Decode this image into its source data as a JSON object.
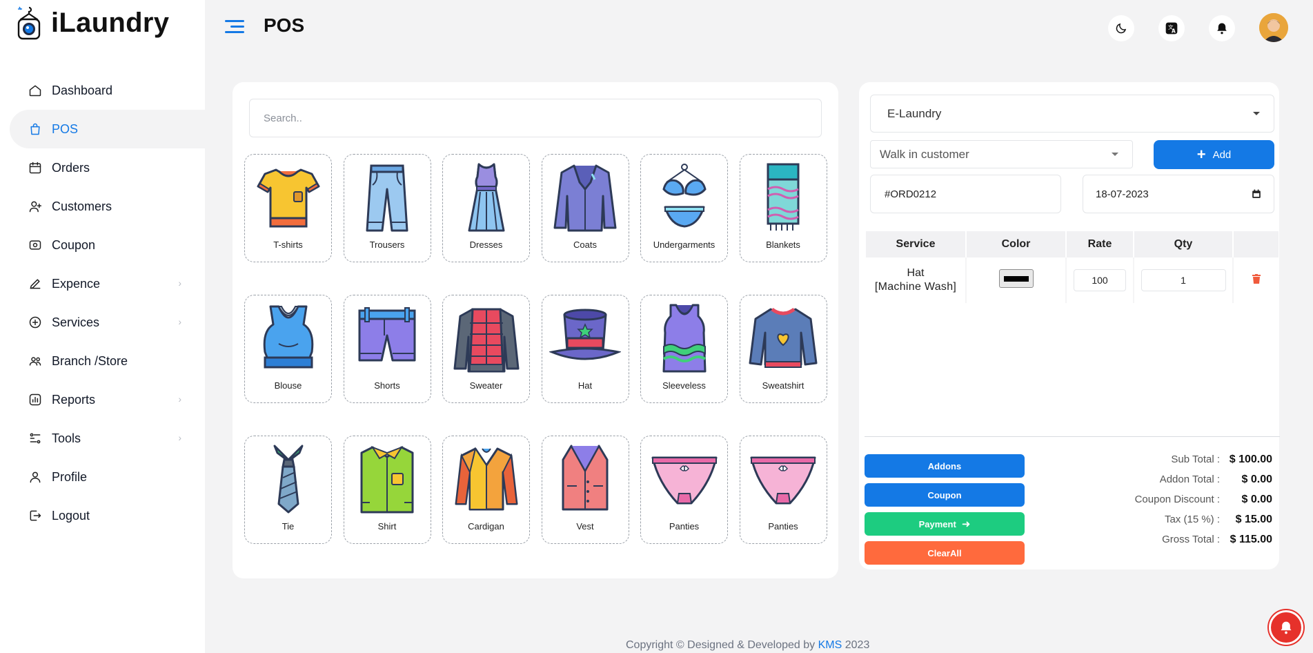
{
  "app": {
    "name": "iLaundry",
    "page_title": "POS"
  },
  "sidebar": {
    "items": [
      {
        "label": "Dashboard",
        "icon": "home-icon",
        "active": false,
        "has_submenu": false
      },
      {
        "label": "POS",
        "icon": "bag-icon",
        "active": true,
        "has_submenu": false
      },
      {
        "label": "Orders",
        "icon": "calendar-icon",
        "active": false,
        "has_submenu": false
      },
      {
        "label": "Customers",
        "icon": "user-plus-icon",
        "active": false,
        "has_submenu": false
      },
      {
        "label": "Coupon",
        "icon": "coupon-icon",
        "active": false,
        "has_submenu": false
      },
      {
        "label": "Expence",
        "icon": "pen-icon",
        "active": false,
        "has_submenu": true
      },
      {
        "label": "Services",
        "icon": "plus-circle-icon",
        "active": false,
        "has_submenu": true
      },
      {
        "label": "Branch /Store",
        "icon": "users-icon",
        "active": false,
        "has_submenu": false
      },
      {
        "label": "Reports",
        "icon": "chart-icon",
        "active": false,
        "has_submenu": true
      },
      {
        "label": "Tools",
        "icon": "tools-icon",
        "active": false,
        "has_submenu": true
      },
      {
        "label": "Profile",
        "icon": "user-icon",
        "active": false,
        "has_submenu": false
      },
      {
        "label": "Logout",
        "icon": "logout-icon",
        "active": false,
        "has_submenu": false
      }
    ]
  },
  "topbar": {
    "icons": [
      "moon-icon",
      "translate-icon",
      "bell-icon"
    ]
  },
  "products": {
    "search_placeholder": "Search..",
    "items": [
      {
        "label": "T-shirts",
        "icon": "tshirt-icon"
      },
      {
        "label": "Trousers",
        "icon": "trousers-icon"
      },
      {
        "label": "Dresses",
        "icon": "dress-icon"
      },
      {
        "label": "Coats",
        "icon": "coat-icon"
      },
      {
        "label": "Undergarments",
        "icon": "undergarments-icon"
      },
      {
        "label": "Blankets",
        "icon": "blanket-icon"
      },
      {
        "label": "Blouse",
        "icon": "blouse-icon"
      },
      {
        "label": "Shorts",
        "icon": "shorts-icon"
      },
      {
        "label": "Sweater",
        "icon": "sweater-icon"
      },
      {
        "label": "Hat",
        "icon": "hat-icon"
      },
      {
        "label": "Sleeveless",
        "icon": "sleeveless-icon"
      },
      {
        "label": "Sweatshirt",
        "icon": "sweatshirt-icon"
      },
      {
        "label": "Tie",
        "icon": "tie-icon"
      },
      {
        "label": "Shirt",
        "icon": "shirt-icon"
      },
      {
        "label": "Cardigan",
        "icon": "cardigan-icon"
      },
      {
        "label": "Vest",
        "icon": "vest-icon"
      },
      {
        "label": "Panties",
        "icon": "panties-icon"
      },
      {
        "label": "Panties",
        "icon": "panties-icon"
      }
    ]
  },
  "order": {
    "store": "E-Laundry",
    "customer": "Walk in customer",
    "add_label": "Add",
    "order_no": "#ORD0212",
    "date": "18-07-2023",
    "columns": [
      "Service",
      "Color",
      "Rate",
      "Qty"
    ],
    "rows": [
      {
        "service": "Hat",
        "method": "[Machine Wash]",
        "color": "#000000",
        "rate": "100",
        "qty": "1"
      }
    ],
    "buttons": {
      "addons": "Addons",
      "coupon": "Coupon",
      "payment": "Payment",
      "clear": "ClearAll"
    },
    "totals": [
      {
        "label": "Sub Total :",
        "value": "$ 100.00"
      },
      {
        "label": "Addon Total :",
        "value": "$ 0.00"
      },
      {
        "label": "Coupon Discount :",
        "value": "$ 0.00"
      },
      {
        "label": "Tax (15 %) :",
        "value": "$ 15.00"
      },
      {
        "label": "Gross Total :",
        "value": "$ 115.00"
      }
    ]
  },
  "footer": {
    "prefix": "Copyright © Designed & Developed by",
    "company": "KMS",
    "year": "2023"
  },
  "colors": {
    "primary": "#1479e5",
    "success": "#1dcc80",
    "danger": "#ff6a3d",
    "notify": "#e6312b"
  }
}
